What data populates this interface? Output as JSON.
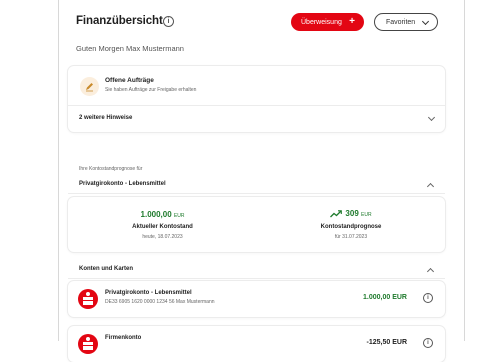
{
  "header": {
    "title": "Finanzübersicht",
    "info_glyph": "i",
    "transfer_label": "Überweisung",
    "transfer_plus": "+",
    "favorites_label": "Favoriten"
  },
  "greeting": "Guten Morgen Max Mustermann",
  "tasks": {
    "title": "Offene Aufträge",
    "subtitle": "Sie haben Aufträge zur Freigabe erhalten",
    "icon": "pen-icon",
    "more_hints": "2 weitere Hinweise"
  },
  "forecast_section": {
    "caption": "Ihre Kontostandprognose für",
    "account": "Privatgirokonto - Lebensmittel",
    "current": {
      "amount": "1.000,00",
      "currency": "EUR",
      "label": "Aktueller Kontostand",
      "date": "heute, 18.07.2023"
    },
    "forecast": {
      "amount": "309",
      "currency": "EUR",
      "label": "Kontostandprognose",
      "date": "für 31.07.2023",
      "trend_icon": "trend-up-icon"
    }
  },
  "accounts_section": {
    "title": "Konten und Karten",
    "accounts": [
      {
        "name": "Privatgirokonto - Lebensmittel",
        "iban": "DE33 6905 1620 0000 1234 56 Max Mustermann",
        "amount": "1.000,00 EUR"
      },
      {
        "name": "Firmenkonto",
        "iban": "",
        "amount": "-125,50 EUR"
      }
    ]
  },
  "colors": {
    "brand_red": "#e30613",
    "positive_green": "#1e7a2c"
  }
}
